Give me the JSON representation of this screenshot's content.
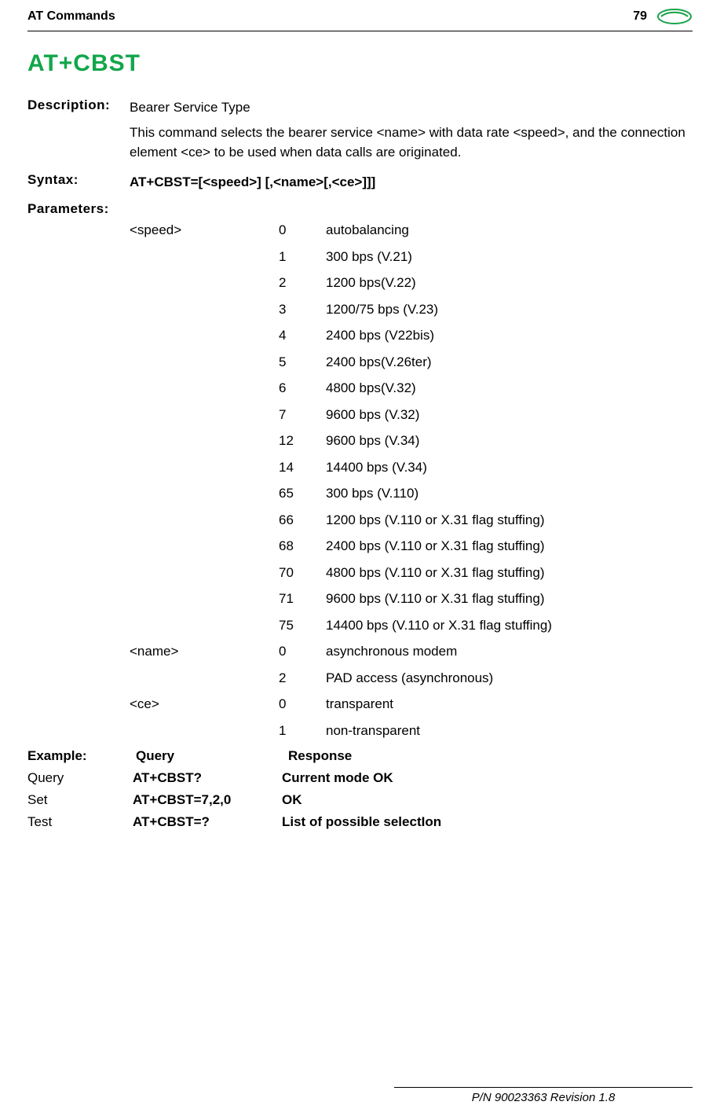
{
  "header": {
    "left": "AT Commands",
    "page": "79"
  },
  "title": "AT+CBST",
  "description_label": "Description:",
  "description_head": "Bearer Service Type",
  "description_body": "This command selects the bearer service <name> with data rate <speed>, and the connection element <ce> to be used when data calls are originated.",
  "syntax_label": "Syntax:",
  "syntax_value": "AT+CBST=[<speed>] [,<name>[,<ce>]]]",
  "params_label": "Parameters:",
  "params_speed_name": "<speed>",
  "params_name_name": "<name>",
  "params_ce_name": "<ce>",
  "speed_rows": [
    {
      "v": "0",
      "d": "autobalancing"
    },
    {
      "v": "1",
      "d": "300 bps (V.21)"
    },
    {
      "v": "2",
      "d": "1200 bps(V.22)"
    },
    {
      "v": "3",
      "d": "1200/75 bps (V.23)"
    },
    {
      "v": "4",
      "d": "2400 bps (V22bis)"
    },
    {
      "v": "5",
      "d": "2400 bps(V.26ter)"
    },
    {
      "v": "6",
      "d": "4800 bps(V.32)"
    },
    {
      "v": "7",
      "d": "9600 bps (V.32)"
    },
    {
      "v": "12",
      "d": "9600 bps (V.34)"
    },
    {
      "v": "14",
      "d": "14400 bps (V.34)"
    },
    {
      "v": "65",
      "d": "300 bps (V.110)"
    },
    {
      "v": "66",
      "d": "1200 bps (V.110 or X.31 flag stuffing)"
    },
    {
      "v": "68",
      "d": "2400 bps (V.110 or X.31 flag stuffing)"
    },
    {
      "v": "70",
      "d": "4800 bps (V.110 or X.31 flag stuffing)"
    },
    {
      "v": "71",
      "d": "9600 bps (V.110 or X.31 flag stuffing)"
    },
    {
      "v": "75",
      "d": "14400 bps (V.110 or X.31 flag stuffing)"
    }
  ],
  "name_rows": [
    {
      "v": "0",
      "d": "asynchronous modem"
    },
    {
      "v": "2",
      "d": "PAD access (asynchronous)"
    }
  ],
  "ce_rows": [
    {
      "v": "0",
      "d": "transparent"
    },
    {
      "v": "1",
      "d": "non-transparent"
    }
  ],
  "example_header": {
    "c1": "Example:",
    "c2": "Query",
    "c3": "Response"
  },
  "example_rows": [
    {
      "c1": "Query",
      "c2": "AT+CBST?",
      "c3": "Current mode OK",
      "bold2": true,
      "bold3": true
    },
    {
      "c1": "Set",
      "c2": "AT+CBST=7,2,0",
      "c3": "OK",
      "bold2": true,
      "bold3": true
    },
    {
      "c1": "Test",
      "c2": "AT+CBST=?",
      "c3": "List of possible selectIon",
      "bold2": true,
      "bold3": true
    }
  ],
  "footer": "P/N 90023363  Revision 1.8"
}
